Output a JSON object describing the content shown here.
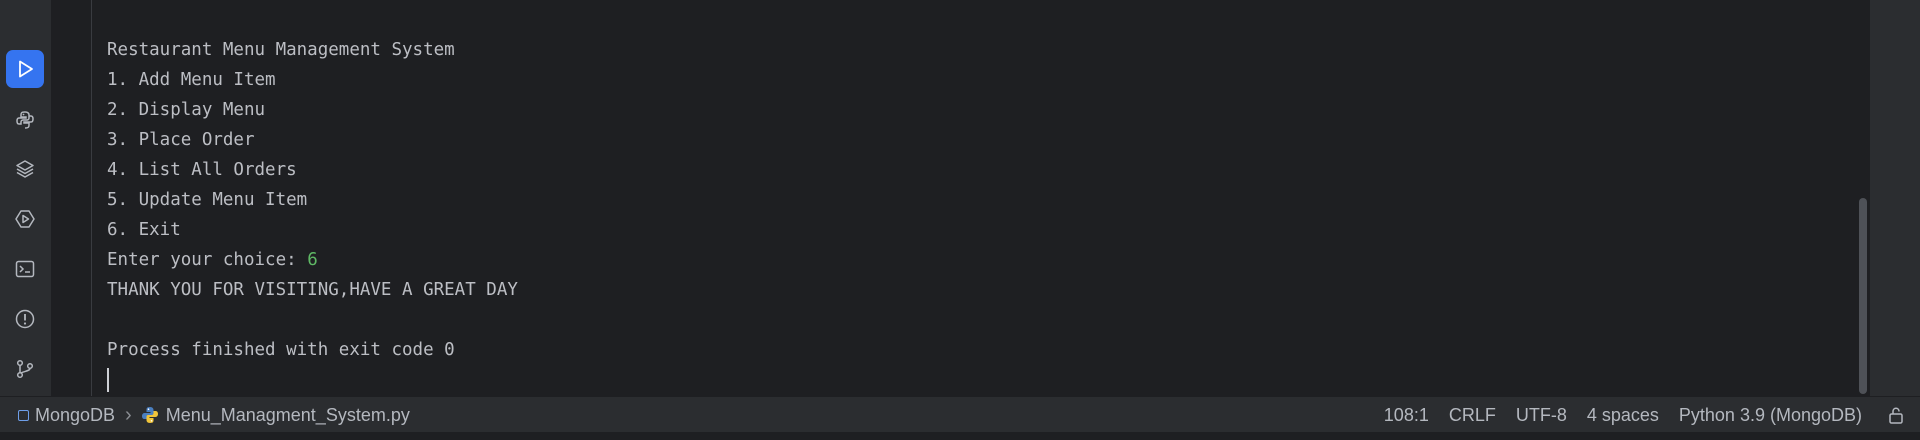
{
  "toolbar": {
    "icons": [
      "run-icon",
      "python-console-icon",
      "layers-icon",
      "services-icon",
      "terminal-icon",
      "problems-icon",
      "git-icon"
    ],
    "accent": "#3574f0"
  },
  "console": {
    "lines": [
      "Restaurant Menu Management System",
      "1. Add Menu Item",
      "2. Display Menu",
      "3. Place Order",
      "4. List All Orders",
      "5. Update Menu Item",
      "6. Exit"
    ],
    "prompt": "Enter your choice: ",
    "user_input": "6",
    "farewell": "THANK YOU FOR VISITING,HAVE A GREAT DAY",
    "exit_message": "Process finished with exit code 0",
    "input_color": "#5fb865"
  },
  "status": {
    "project": "MongoDB",
    "file": "Menu_Managment_System.py",
    "position": "108:1",
    "line_ending": "CRLF",
    "encoding": "UTF-8",
    "indent": "4 spaces",
    "interpreter": "Python 3.9 (MongoDB)"
  }
}
